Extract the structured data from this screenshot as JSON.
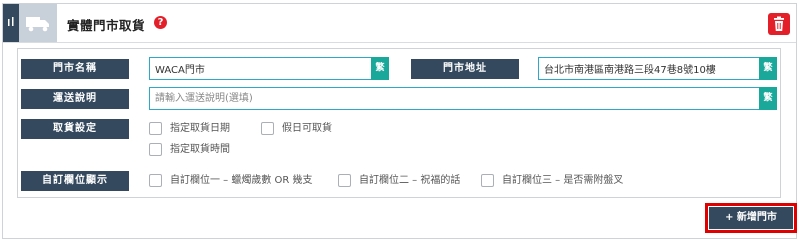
{
  "section": {
    "title": "實體門市取貨",
    "help_glyph": "?",
    "icons": {
      "drag": "drag-handle-icon",
      "section": "truck-icon",
      "delete": "trash-icon"
    }
  },
  "fields": {
    "store_name": {
      "label": "門市名稱",
      "value": "WACA門市",
      "lang_btn": "繁"
    },
    "store_address": {
      "label": "門市地址",
      "value": "台北市南港區南港路三段47巷8號10樓",
      "lang_btn": "繁"
    },
    "shipping_desc": {
      "label": "運送說明",
      "placeholder": "請輸入運送說明(選填)",
      "lang_btn": "繁"
    }
  },
  "pickup_settings": {
    "label": "取貨設定",
    "options": [
      "指定取貨日期",
      "假日可取貨",
      "指定取貨時間"
    ]
  },
  "custom_fields": {
    "label": "自訂欄位顯示",
    "options": [
      "自訂欄位一 – 蠟燭歲數 OR 幾支",
      "自訂欄位二 – 祝福的話",
      "自訂欄位三 – 是否需附盤叉"
    ]
  },
  "add_store_button": "+ 新增門市",
  "colors": {
    "accent": "#34495e",
    "danger": "#e3202a",
    "teal": "#1aa89a",
    "input_border": "#2fa8c8"
  }
}
